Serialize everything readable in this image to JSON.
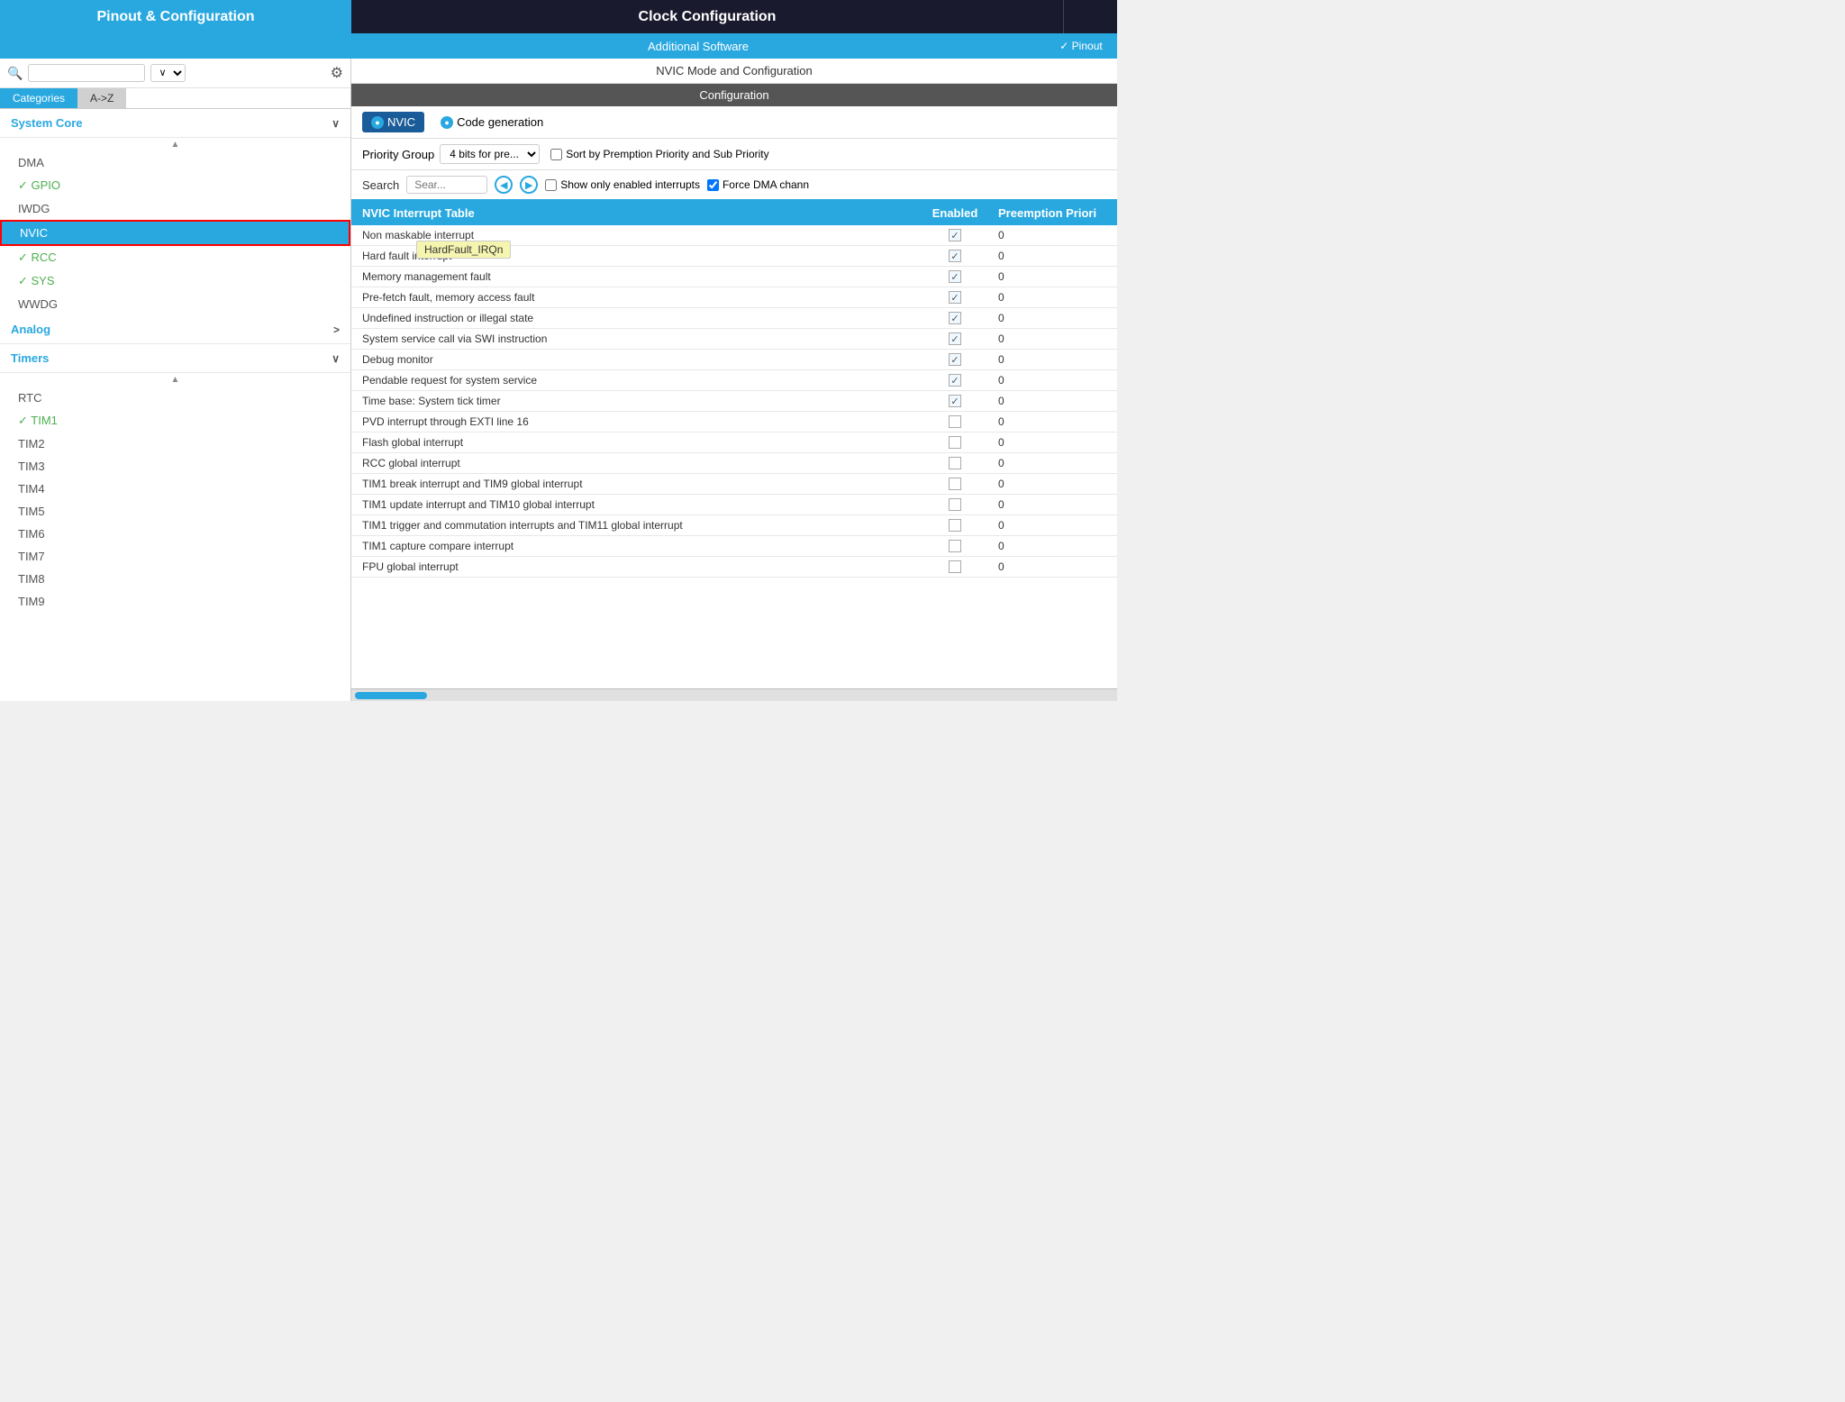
{
  "header": {
    "pinout_label": "Pinout & Configuration",
    "clock_label": "Clock Configuration",
    "extra_label": ""
  },
  "subheader": {
    "additional_software": "Additional Software",
    "pinout_label": "✓ Pinout"
  },
  "sidebar": {
    "search_placeholder": "",
    "dropdown_value": "∨",
    "tabs": [
      {
        "label": "Categories",
        "active": true
      },
      {
        "label": "A->Z",
        "active": false
      }
    ],
    "sections": [
      {
        "title": "System Core",
        "expanded": true,
        "arrow": "∨",
        "items": [
          {
            "label": "DMA",
            "type": "normal"
          },
          {
            "label": "GPIO",
            "type": "green"
          },
          {
            "label": "IWDG",
            "type": "normal"
          },
          {
            "label": "NVIC",
            "type": "active"
          },
          {
            "label": "RCC",
            "type": "green-check"
          },
          {
            "label": "SYS",
            "type": "green-check"
          },
          {
            "label": "WWDG",
            "type": "normal"
          }
        ]
      },
      {
        "title": "Analog",
        "expanded": false,
        "arrow": ">"
      },
      {
        "title": "Timers",
        "expanded": true,
        "arrow": "∨",
        "items": [
          {
            "label": "RTC",
            "type": "normal"
          },
          {
            "label": "TIM1",
            "type": "green-check"
          },
          {
            "label": "TIM2",
            "type": "normal"
          },
          {
            "label": "TIM3",
            "type": "normal"
          },
          {
            "label": "TIM4",
            "type": "normal"
          },
          {
            "label": "TIM5",
            "type": "normal"
          },
          {
            "label": "TIM6",
            "type": "normal"
          },
          {
            "label": "TIM7",
            "type": "normal"
          },
          {
            "label": "TIM8",
            "type": "normal"
          },
          {
            "label": "TIM9",
            "type": "normal"
          }
        ]
      }
    ]
  },
  "content": {
    "mode_bar": "NVIC Mode and Configuration",
    "config_bar": "Configuration",
    "tabs": [
      {
        "label": "NVIC",
        "active": true
      },
      {
        "label": "Code generation",
        "active": false
      }
    ],
    "priority_group_label": "Priority Group",
    "priority_group_value": "4 bits for pre...",
    "sort_checkbox_label": "Sort by Premption Priority and Sub Priority",
    "search_label": "Search",
    "search_placeholder": "Sear...",
    "show_enabled_label": "Show only enabled interrupts",
    "force_dma_label": "Force DMA chann",
    "force_dma_checked": true,
    "table": {
      "headers": [
        "NVIC Interrupt Table",
        "Enabled",
        "Preemption Priori"
      ],
      "rows": [
        {
          "interrupt": "Non maskable interrupt",
          "enabled": true,
          "preemption": "0"
        },
        {
          "interrupt": "Hard fault interrupt",
          "enabled": true,
          "preemption": "0"
        },
        {
          "interrupt": "Memory management fault",
          "enabled": true,
          "preemption": "0"
        },
        {
          "interrupt": "Pre-fetch fault, memory access fault",
          "enabled": true,
          "preemption": "0"
        },
        {
          "interrupt": "Undefined instruction or illegal state",
          "enabled": true,
          "preemption": "0"
        },
        {
          "interrupt": "System service call via SWI instruction",
          "enabled": true,
          "preemption": "0"
        },
        {
          "interrupt": "Debug monitor",
          "enabled": true,
          "preemption": "0"
        },
        {
          "interrupt": "Pendable request for system service",
          "enabled": true,
          "preemption": "0"
        },
        {
          "interrupt": "Time base: System tick timer",
          "enabled": true,
          "preemption": "0"
        },
        {
          "interrupt": "PVD interrupt through EXTI line 16",
          "enabled": false,
          "preemption": "0"
        },
        {
          "interrupt": "Flash global interrupt",
          "enabled": false,
          "preemption": "0"
        },
        {
          "interrupt": "RCC global interrupt",
          "enabled": false,
          "preemption": "0"
        },
        {
          "interrupt": "TIM1 break interrupt and TIM9 global interrupt",
          "enabled": false,
          "preemption": "0"
        },
        {
          "interrupt": "TIM1 update interrupt and TIM10 global interrupt",
          "enabled": false,
          "preemption": "0"
        },
        {
          "interrupt": "TIM1 trigger and commutation interrupts and TIM11 global interrupt",
          "enabled": false,
          "preemption": "0"
        },
        {
          "interrupt": "TIM1 capture compare interrupt",
          "enabled": false,
          "preemption": "0"
        },
        {
          "interrupt": "FPU global interrupt",
          "enabled": false,
          "preemption": "0"
        }
      ]
    },
    "tooltip": "HardFault_IRQn"
  }
}
